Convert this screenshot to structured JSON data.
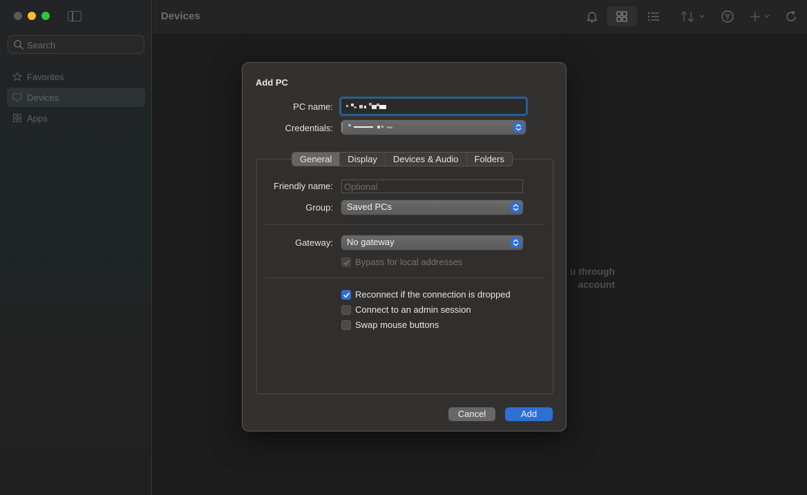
{
  "window": {
    "title": "Devices"
  },
  "sidebar": {
    "search_placeholder": "Search",
    "items": [
      {
        "label": "Favorites",
        "icon": "star-icon"
      },
      {
        "label": "Devices",
        "icon": "monitor-icon",
        "selected": true
      },
      {
        "label": "Apps",
        "icon": "apps-grid-icon"
      }
    ]
  },
  "toolbar": {
    "icons": [
      "bell-icon",
      "grid-view-icon",
      "list-view-icon",
      "sort-icon",
      "filter-icon",
      "add-icon",
      "refresh-icon"
    ]
  },
  "background_message": {
    "line1": "u through",
    "line2": "account"
  },
  "dialog": {
    "title": "Add PC",
    "pc_name_label": "PC name:",
    "credentials_label": "Credentials:",
    "tabs": [
      "General",
      "Display",
      "Devices & Audio",
      "Folders"
    ],
    "active_tab": "General",
    "friendly_name_label": "Friendly name:",
    "friendly_name_placeholder": "Optional",
    "group_label": "Group:",
    "group_value": "Saved PCs",
    "gateway_label": "Gateway:",
    "gateway_value": "No gateway",
    "bypass_label": "Bypass for local addresses",
    "reconnect_label": "Reconnect if the connection is dropped",
    "admin_session_label": "Connect to an admin session",
    "swap_mouse_label": "Swap mouse buttons",
    "cancel_label": "Cancel",
    "add_label": "Add"
  },
  "checkboxes": {
    "bypass_checked": true,
    "reconnect_checked": true,
    "admin_checked": false,
    "swap_checked": false
  },
  "colors": {
    "accent": "#2e6fd4",
    "focus_ring": "#2a5f92",
    "dialog_bg": "#323130"
  }
}
